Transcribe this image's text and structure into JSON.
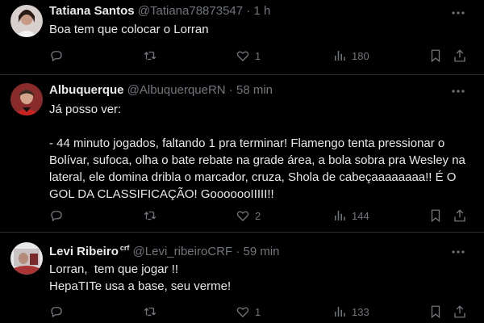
{
  "tweets": [
    {
      "name": "Tatiana Santos",
      "badge": "",
      "handle": "@Tatiana78873547",
      "dot": "·",
      "time": "1 h",
      "text": "Boa tem que colocar o Lorran",
      "replies": "",
      "retweets": "",
      "likes": "1",
      "views": "180",
      "avatar_icon": "user-photo-avatar"
    },
    {
      "name": "Albuquerque",
      "badge": "",
      "handle": "@AlbuquerqueRN",
      "dot": "·",
      "time": "58 min",
      "text": "Já posso ver:\n\n- 44 minuto jogados, faltando 1 pra terminar! Flamengo tenta pressionar o Bolívar, sufoca, olha o bate rebate na grade área, a bola sobra pra Wesley na lateral, ele domina dribla o marcador, cruza, Shola de cabeçaaaaaaaa!! É O GOL DA CLASSIFICAÇÃO! GooooooIIIII!!",
      "replies": "",
      "retweets": "",
      "likes": "2",
      "views": "144",
      "avatar_icon": "user-photo-avatar"
    },
    {
      "name": "Levi Ribeiro",
      "badge": "crf",
      "handle": "@Levi_ribeiroCRF",
      "dot": "·",
      "time": "59 min",
      "text": "Lorran,  tem que jogar !!\nHepaTITe usa a base, seu verme!",
      "replies": "",
      "retweets": "",
      "likes": "1",
      "views": "133",
      "avatar_icon": "user-photo-avatar"
    }
  ],
  "colors": {
    "background": "#000000",
    "text": "#e7e9ea",
    "secondary": "#71767b",
    "divider": "#2f3336"
  },
  "icons": [
    "reply-icon",
    "retweet-icon",
    "like-icon",
    "views-icon",
    "bookmark-icon",
    "share-icon",
    "more-icon"
  ]
}
